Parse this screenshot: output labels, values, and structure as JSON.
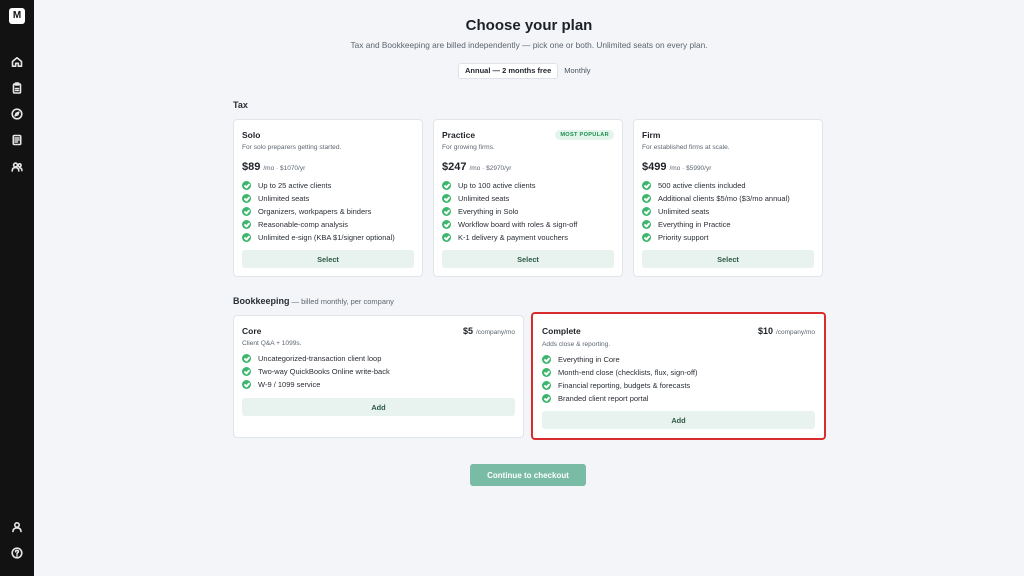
{
  "sidebar": {
    "logo": "M",
    "top_icons": [
      "home-icon",
      "clipboard-icon",
      "compass-icon",
      "document-icon",
      "users-icon"
    ],
    "bottom_icons": [
      "user-icon",
      "help-icon"
    ]
  },
  "header": {
    "title": "Choose your plan",
    "subtitle": "Tax and Bookkeeping are billed independently — pick one or both. Unlimited seats on every plan."
  },
  "billing_toggle": {
    "options": [
      "Annual — 2 months free",
      "Monthly"
    ],
    "selected": "Annual — 2 months free"
  },
  "tax": {
    "label": "Tax",
    "plans": [
      {
        "name": "Solo",
        "description": "For solo preparers getting started.",
        "price": "$89",
        "price_detail": "/mo · $1070/yr",
        "badge": "",
        "features": [
          "Up to 25 active clients",
          "Unlimited seats",
          "Organizers, workpapers & binders",
          "Reasonable-comp analysis",
          "Unlimited e-sign (KBA $1/signer optional)"
        ],
        "button": "Select"
      },
      {
        "name": "Practice",
        "description": "For growing firms.",
        "price": "$247",
        "price_detail": "/mo · $2970/yr",
        "badge": "MOST POPULAR",
        "features": [
          "Up to 100 active clients",
          "Unlimited seats",
          "Everything in Solo",
          "Workflow board with roles & sign-off",
          "K-1 delivery & payment vouchers"
        ],
        "button": "Select"
      },
      {
        "name": "Firm",
        "description": "For established firms at scale.",
        "price": "$499",
        "price_detail": "/mo · $5990/yr",
        "badge": "",
        "features": [
          "500 active clients included",
          "Additional clients $5/mo ($3/mo annual)",
          "Unlimited seats",
          "Everything in Practice",
          "Priority support"
        ],
        "button": "Select"
      }
    ]
  },
  "bookkeeping": {
    "label": "Bookkeeping",
    "note": "— billed monthly, per company",
    "plans": [
      {
        "name": "Core",
        "description": "Client Q&A + 1099s.",
        "price": "$5",
        "price_detail": "/company/mo",
        "features": [
          "Uncategorized-transaction client loop",
          "Two-way QuickBooks Online write-back",
          "W-9 / 1099 service"
        ],
        "button": "Add",
        "selected": false
      },
      {
        "name": "Complete",
        "description": "Adds close & reporting.",
        "price": "$10",
        "price_detail": "/company/mo",
        "features": [
          "Everything in Core",
          "Month-end close (checklists, flux, sign-off)",
          "Financial reporting, budgets & forecasts",
          "Branded client report portal"
        ],
        "button": "Add",
        "selected": true
      }
    ]
  },
  "checkout": {
    "label": "Continue to checkout"
  },
  "colors": {
    "sidebar": "#121212",
    "background": "#f3f5f8",
    "check": "#3cb66c",
    "badge_text": "#1c8c4f",
    "button_bg": "#e8f2ef",
    "checkout_bg": "#79bba4",
    "highlight_border": "#d92d2d"
  }
}
